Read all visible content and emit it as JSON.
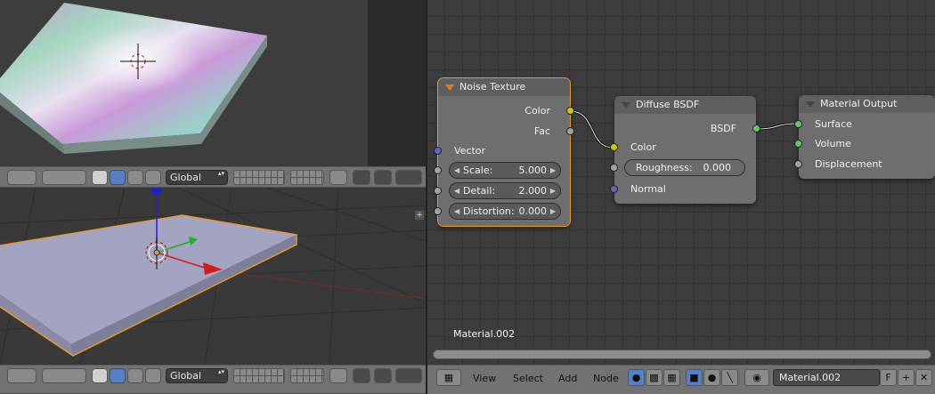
{
  "viewport_header": {
    "orientation": "Global"
  },
  "nodes": {
    "noise_texture": {
      "title": "Noise Texture",
      "outputs": [
        "Color",
        "Fac"
      ],
      "inputs": [
        "Vector"
      ],
      "fields": [
        {
          "label": "Scale:",
          "value": "5.000"
        },
        {
          "label": "Detail:",
          "value": "2.000"
        },
        {
          "label": "Distortion:",
          "value": "0.000"
        }
      ]
    },
    "diffuse_bsdf": {
      "title": "Diffuse BSDF",
      "output": "BSDF",
      "input_color": "Color",
      "roughness": {
        "label": "Roughness:",
        "value": "0.000"
      },
      "input_normal": "Normal"
    },
    "material_output": {
      "title": "Material Output",
      "inputs": [
        "Surface",
        "Volume",
        "Displacement"
      ]
    }
  },
  "node_editor": {
    "material_label": "Material.002",
    "menus": [
      "View",
      "Select",
      "Add",
      "Node"
    ],
    "material_field": "Material.002",
    "fake_user": "F"
  },
  "colors": {
    "accent_orange": "#e39a3b",
    "socket_yellow": "#c7c729",
    "socket_grey": "#a1a1a1",
    "socket_blue": "#6363c7",
    "socket_green": "#63c763"
  }
}
